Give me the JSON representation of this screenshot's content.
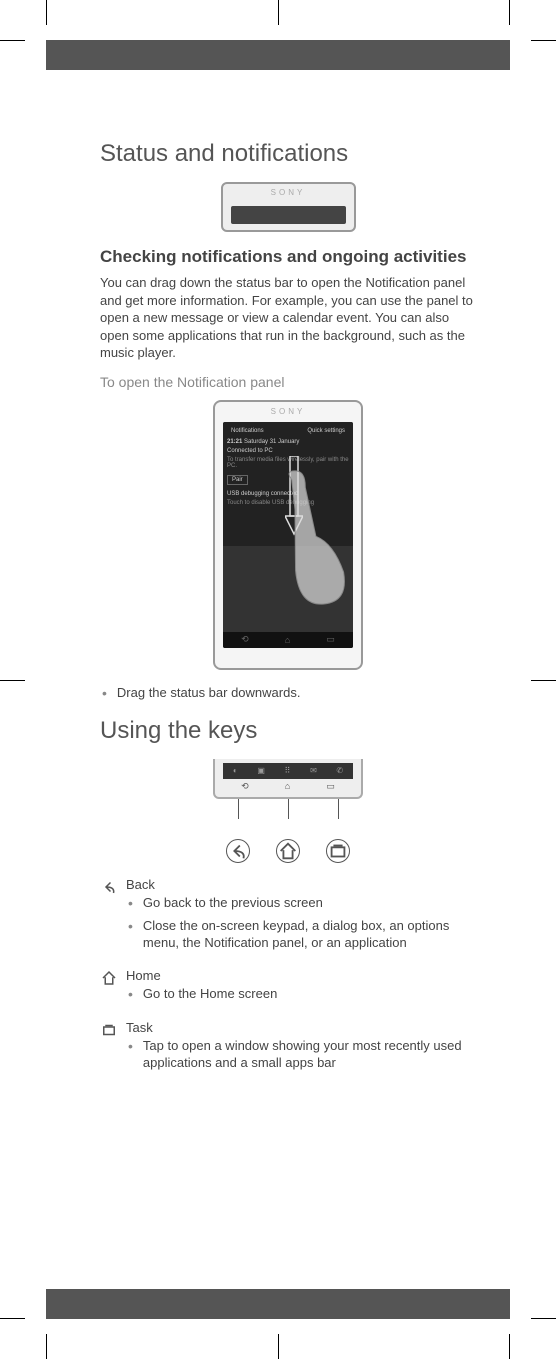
{
  "title1": "Status and notifications",
  "section1": {
    "heading": "Checking notifications and ongoing activities",
    "body": "You can drag down the status bar to open the Notification panel and get more information. For example, you can use the panel to open a new message or view a calendar event. You can also open some applications that run in the background, such as the music player.",
    "subhead": "To open the Notification panel",
    "step": "Drag the status bar downwards."
  },
  "panel_fig": {
    "tab_left": "Notifications",
    "tab_right": "Quick settings",
    "time": "21:21",
    "date": "Saturday 31 January",
    "row1_title": "Connected to PC",
    "row1_sub": "To transfer media files wirelessly, pair with the PC.",
    "row1_btn": "Pair",
    "row2_title": "USB debugging connected",
    "row2_sub": "Touch to disable USB debugging"
  },
  "title2": "Using the keys",
  "keys": {
    "back": {
      "name": "Back",
      "pts": [
        "Go back to the previous screen",
        "Close the on-screen keypad, a dialog box, an options menu, the Notification panel, or an application"
      ]
    },
    "home": {
      "name": "Home",
      "pts": [
        "Go to the Home screen"
      ]
    },
    "task": {
      "name": "Task",
      "pts": [
        "Tap to open a window showing your most recently used applications and a small apps bar"
      ]
    }
  }
}
